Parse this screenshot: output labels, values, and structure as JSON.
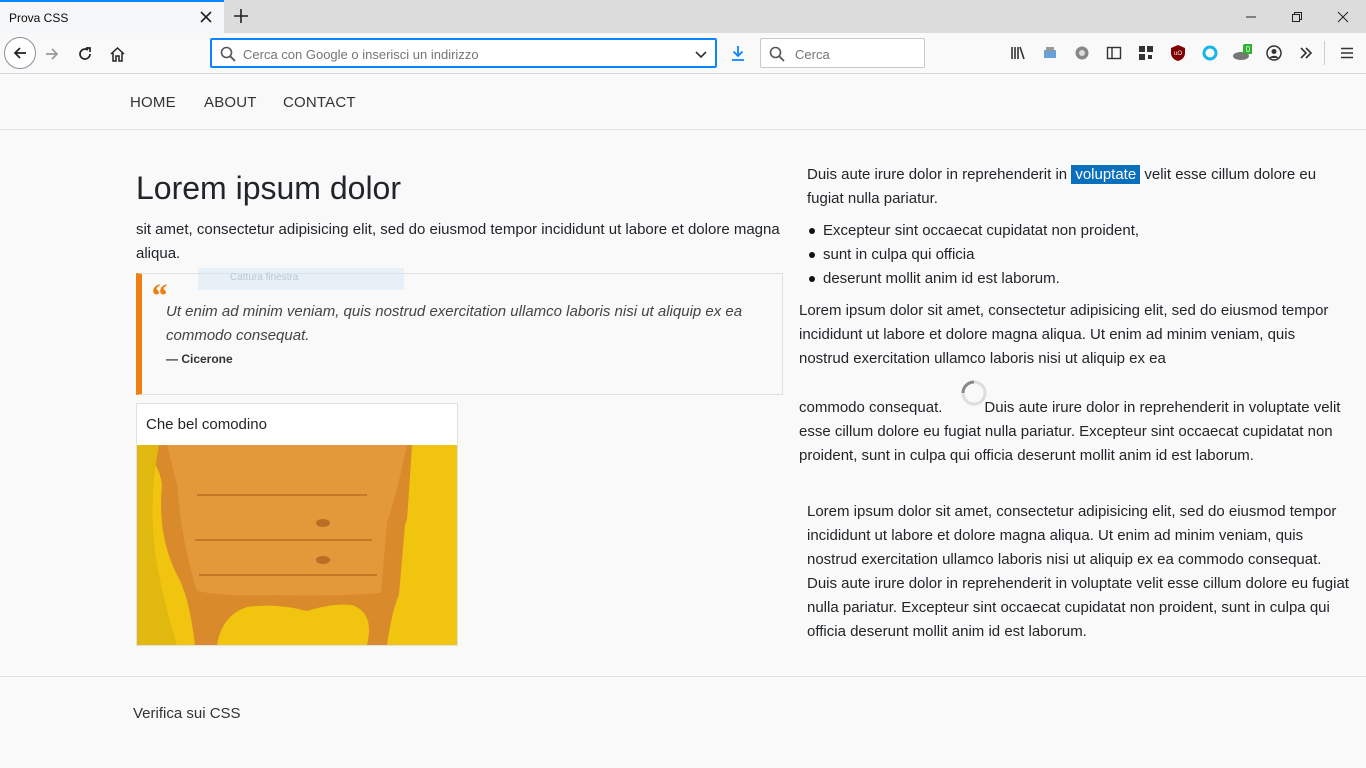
{
  "browser": {
    "tab_title": "Prova CSS",
    "url_placeholder": "Cerca con Google o inserisci un indirizzo",
    "search_placeholder": "Cerca",
    "badge_count": "0",
    "accent": "#0a84ff"
  },
  "nav": {
    "items": [
      "HOME",
      "ABOUT",
      "CONTACT"
    ]
  },
  "main": {
    "title": "Lorem ipsum dolor",
    "lead": "sit amet, consectetur adipisicing elit, sed do eiusmod tempor incididunt ut labore et dolore magna aliqua.",
    "ghost_label": "Cattura finestra",
    "quote": {
      "text": "Ut enim ad minim veniam, quis nostrud exercitation ullamco laboris nisi ut aliquip ex ea commodo consequat.",
      "author": "— Cicerone",
      "accent": "#f07f13"
    },
    "card": {
      "title": "Che bel comodino"
    }
  },
  "right": {
    "p1_before": "Duis aute irure dolor in reprehenderit in ",
    "p1_highlight": "voluptate",
    "p1_after": " velit esse cillum dolore eu fugiat nulla pariatur.",
    "list": [
      "Excepteur sint occaecat cupidatat non proident,",
      "sunt in culpa qui officia",
      "deserunt mollit anim id est laborum."
    ],
    "p2": "Lorem ipsum dolor sit amet, consectetur adipisicing elit, sed do eiusmod tempor incididunt ut labore et dolore magna aliqua. Ut enim ad minim veniam, quis nostrud exercitation ullamco laboris nisi ut aliquip ex ea",
    "p3_start": "commodo consequat.",
    "p3_rest": "Duis aute irure dolor in reprehenderit in voluptate velit esse cillum dolore eu fugiat nulla pariatur. Excepteur sint occaecat cupidatat non proident, sunt in culpa qui officia deserunt mollit anim id est laborum.",
    "p4": "Lorem ipsum dolor sit amet, consectetur adipisicing elit, sed do eiusmod tempor incididunt ut labore et dolore magna aliqua. Ut enim ad minim veniam, quis nostrud exercitation ullamco laboris nisi ut aliquip ex ea commodo consequat. Duis aute irure dolor in reprehenderit in voluptate velit esse cillum dolore eu fugiat nulla pariatur. Excepteur sint occaecat cupidatat non proident, sunt in culpa qui officia deserunt mollit anim id est laborum.",
    "highlight_color": "#0a6fbd"
  },
  "footer": {
    "text": "Verifica sui CSS"
  }
}
